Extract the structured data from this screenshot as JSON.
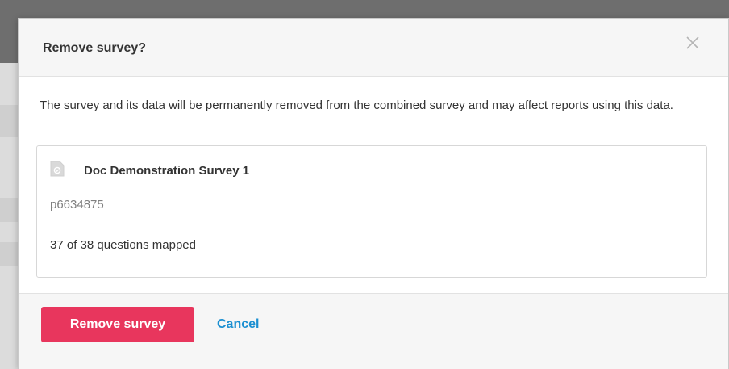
{
  "dialog": {
    "title": "Remove survey?",
    "close_icon": "close-icon",
    "message": "The survey and its data will be permanently removed from the combined survey and may affect reports using this data."
  },
  "survey": {
    "icon": "survey-document-icon",
    "name": "Doc Demonstration Survey 1",
    "id": "p6634875",
    "mapping": "37 of 38 questions mapped"
  },
  "footer": {
    "remove_label": "Remove survey",
    "cancel_label": "Cancel"
  },
  "colors": {
    "primary_danger": "#e8365d",
    "link": "#1a8fd1",
    "header_bg": "#f6f6f6"
  }
}
